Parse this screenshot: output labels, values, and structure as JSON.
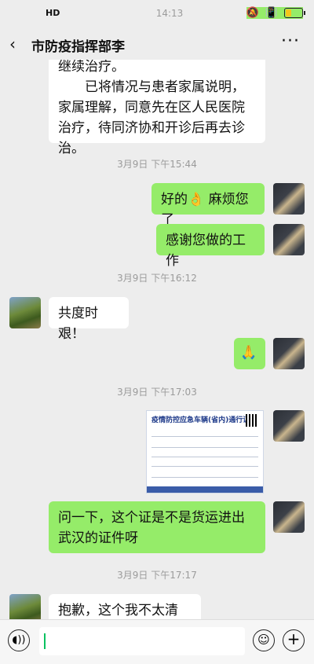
{
  "status_bar": {
    "time": "14:13",
    "network": "HD"
  },
  "header": {
    "back_icon": "‹",
    "title": "市防疫指挥部李",
    "more_icon": "···"
  },
  "messages": {
    "m1": "继续治疗。",
    "m2": "已将情况与患者家属说明，家属理解，同意先在区人民医院治疗，待同济协和开诊后再去诊治。",
    "t1": "3月9日 下午15:44",
    "m3": "好的👌 麻烦您了",
    "m4": "感谢您做的工作",
    "t2": "3月9日 下午16:12",
    "m5": "共度时艰！",
    "m6": "🙏",
    "t3": "3月9日 下午17:03",
    "pass_title": "疫情防控应急车辆(省内)通行证",
    "m7": "问一下，这个证是不是货运进出武汉的证件呀",
    "t4": "3月9日 下午17:17",
    "m8": "抱歉，这个我不太清楚。"
  },
  "input": {
    "placeholder": ""
  },
  "colors": {
    "bubble_self": "#95ec69",
    "bubble_other": "#ffffff",
    "background": "#ededed"
  }
}
